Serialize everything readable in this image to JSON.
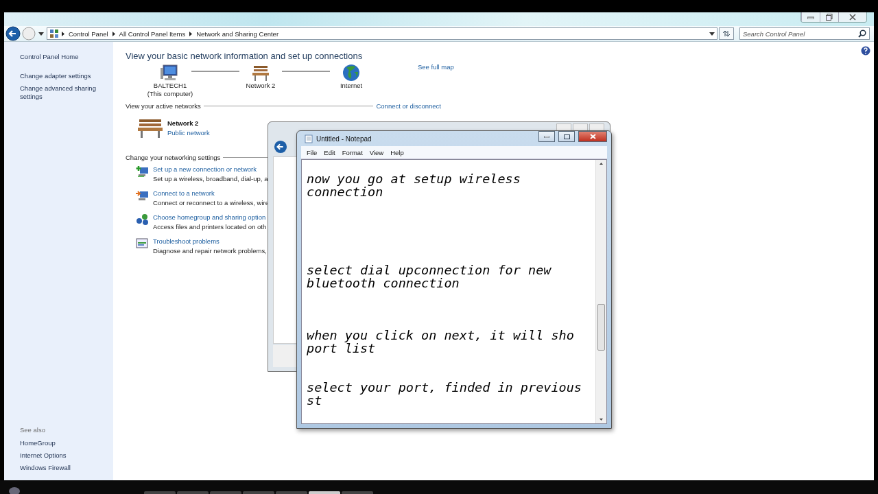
{
  "window": {
    "breadcrumb": [
      "Control Panel",
      "All Control Panel Items",
      "Network and Sharing Center"
    ],
    "search": {
      "placeholder": "Search Control Panel"
    }
  },
  "sidebar": {
    "items": [
      {
        "label": "Control Panel Home",
        "kind": "home"
      },
      {
        "label": "Change adapter settings",
        "kind": "task"
      },
      {
        "label": "Change advanced sharing settings",
        "kind": "task"
      }
    ],
    "see_also": {
      "title": "See also",
      "items": [
        "HomeGroup",
        "Internet Options",
        "Windows Firewall"
      ]
    }
  },
  "main": {
    "heading": "View your basic network information and set up connections",
    "map": {
      "nodes": [
        {
          "kind": "computer",
          "label": "BALTECH1",
          "sublabel": "(This computer)"
        },
        {
          "kind": "bench",
          "label": "Network  2"
        },
        {
          "kind": "globe",
          "label": "Internet"
        }
      ],
      "link": "See full map"
    },
    "active_networks": {
      "title": "View your active networks",
      "link": "Connect or disconnect",
      "network": {
        "name": "Network  2",
        "type": "Public network"
      }
    },
    "settings": {
      "title": "Change your networking settings",
      "tasks": [
        {
          "kind": "new",
          "link": "Set up a new connection or network",
          "description": "Set up a wireless, broadband, dial-up, a"
        },
        {
          "kind": "connect",
          "link": "Connect to a network",
          "description": "Connect or reconnect to a wireless, wire"
        },
        {
          "kind": "homegroup",
          "link": "Choose homegroup and sharing option",
          "description": "Access files and printers located on oth"
        },
        {
          "kind": "troubleshoot",
          "link": "Troubleshoot problems",
          "description": "Diagnose and repair network problems,"
        }
      ]
    }
  },
  "notepad": {
    "title": "Untitled - Notepad",
    "menu": [
      "File",
      "Edit",
      "Format",
      "View",
      "Help"
    ],
    "text": "now you go at setup wireless connection\n\n\n\n\n\nselect dial upconnection for new bluetooth connection\n\n\n\nwhen you click on next, it will sho port list\n\n\nselect your port, finded in previous st"
  }
}
